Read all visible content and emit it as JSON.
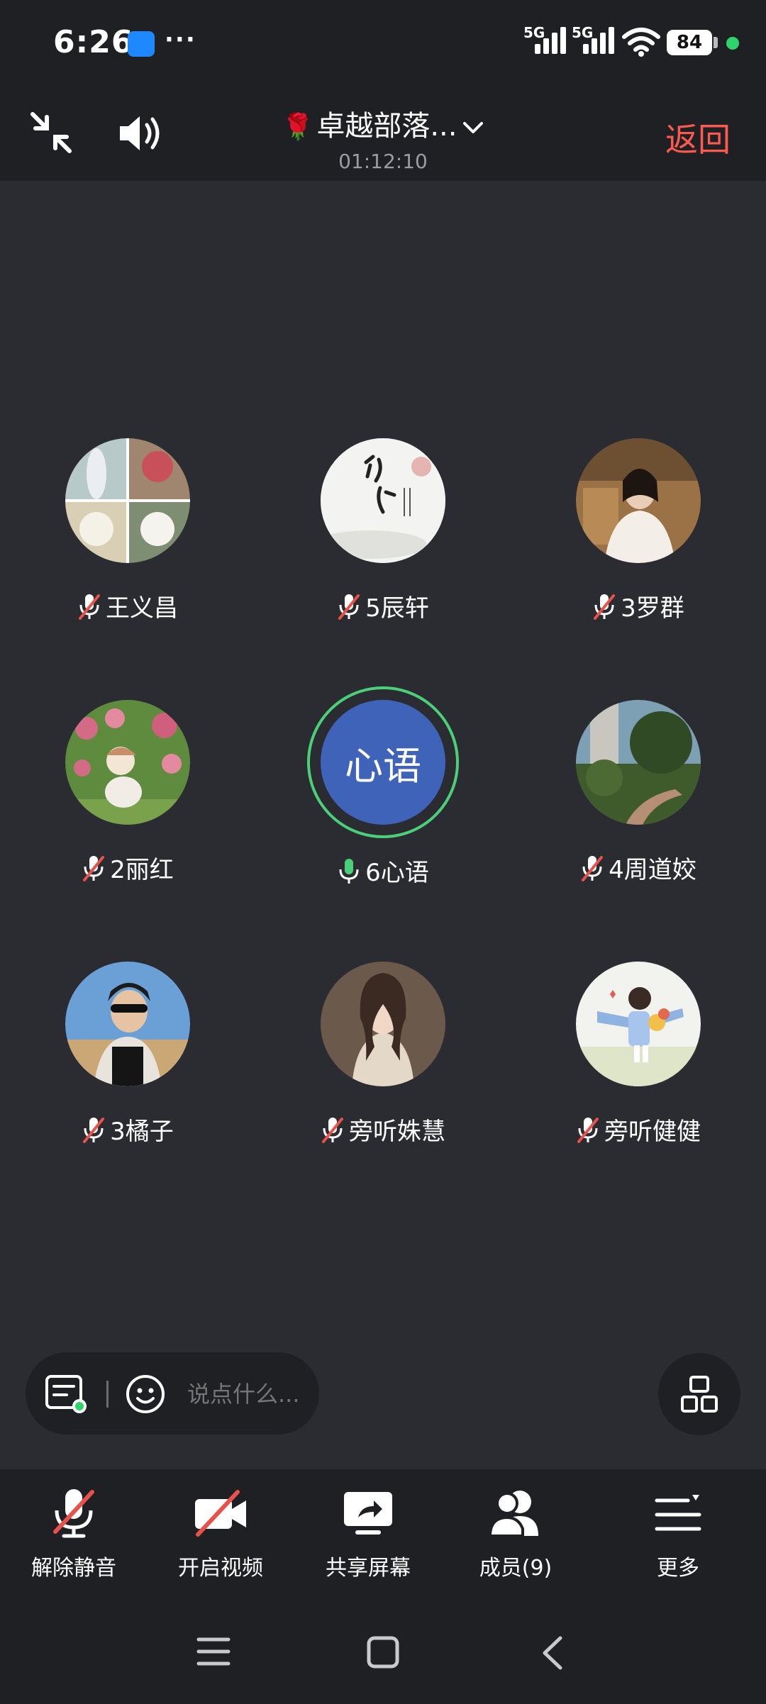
{
  "status_bar": {
    "time": "6:26",
    "network_1": "5G",
    "network_2": "5G",
    "battery": "84",
    "more": "···"
  },
  "header": {
    "title": "卓越部落...",
    "title_emoji": "🌹",
    "timer": "01:12:10",
    "back_label": "返回"
  },
  "participants": [
    {
      "name": "王义昌",
      "muted": true
    },
    {
      "name": "5辰轩",
      "muted": true
    },
    {
      "name": "3罗群",
      "muted": true
    },
    {
      "name": "2丽红",
      "muted": true
    },
    {
      "name": "6心语",
      "muted": false,
      "avatar_text": "心语",
      "speaking": true
    },
    {
      "name": "4周道姣",
      "muted": true
    },
    {
      "name": "3橘子",
      "muted": true
    },
    {
      "name": "旁听姝慧",
      "muted": true
    },
    {
      "name": "旁听健健",
      "muted": true
    }
  ],
  "chat": {
    "placeholder": "说点什么..."
  },
  "toolbar": {
    "unmute": "解除静音",
    "video": "开启视频",
    "share": "共享屏幕",
    "members": "成员(9)",
    "more": "更多"
  },
  "colors": {
    "background": "#2b2c31",
    "bar": "#1f2024",
    "accent_red": "#ff5a4f",
    "speaking_green": "#4bd07a",
    "avatar_blue": "#3f63b8"
  }
}
